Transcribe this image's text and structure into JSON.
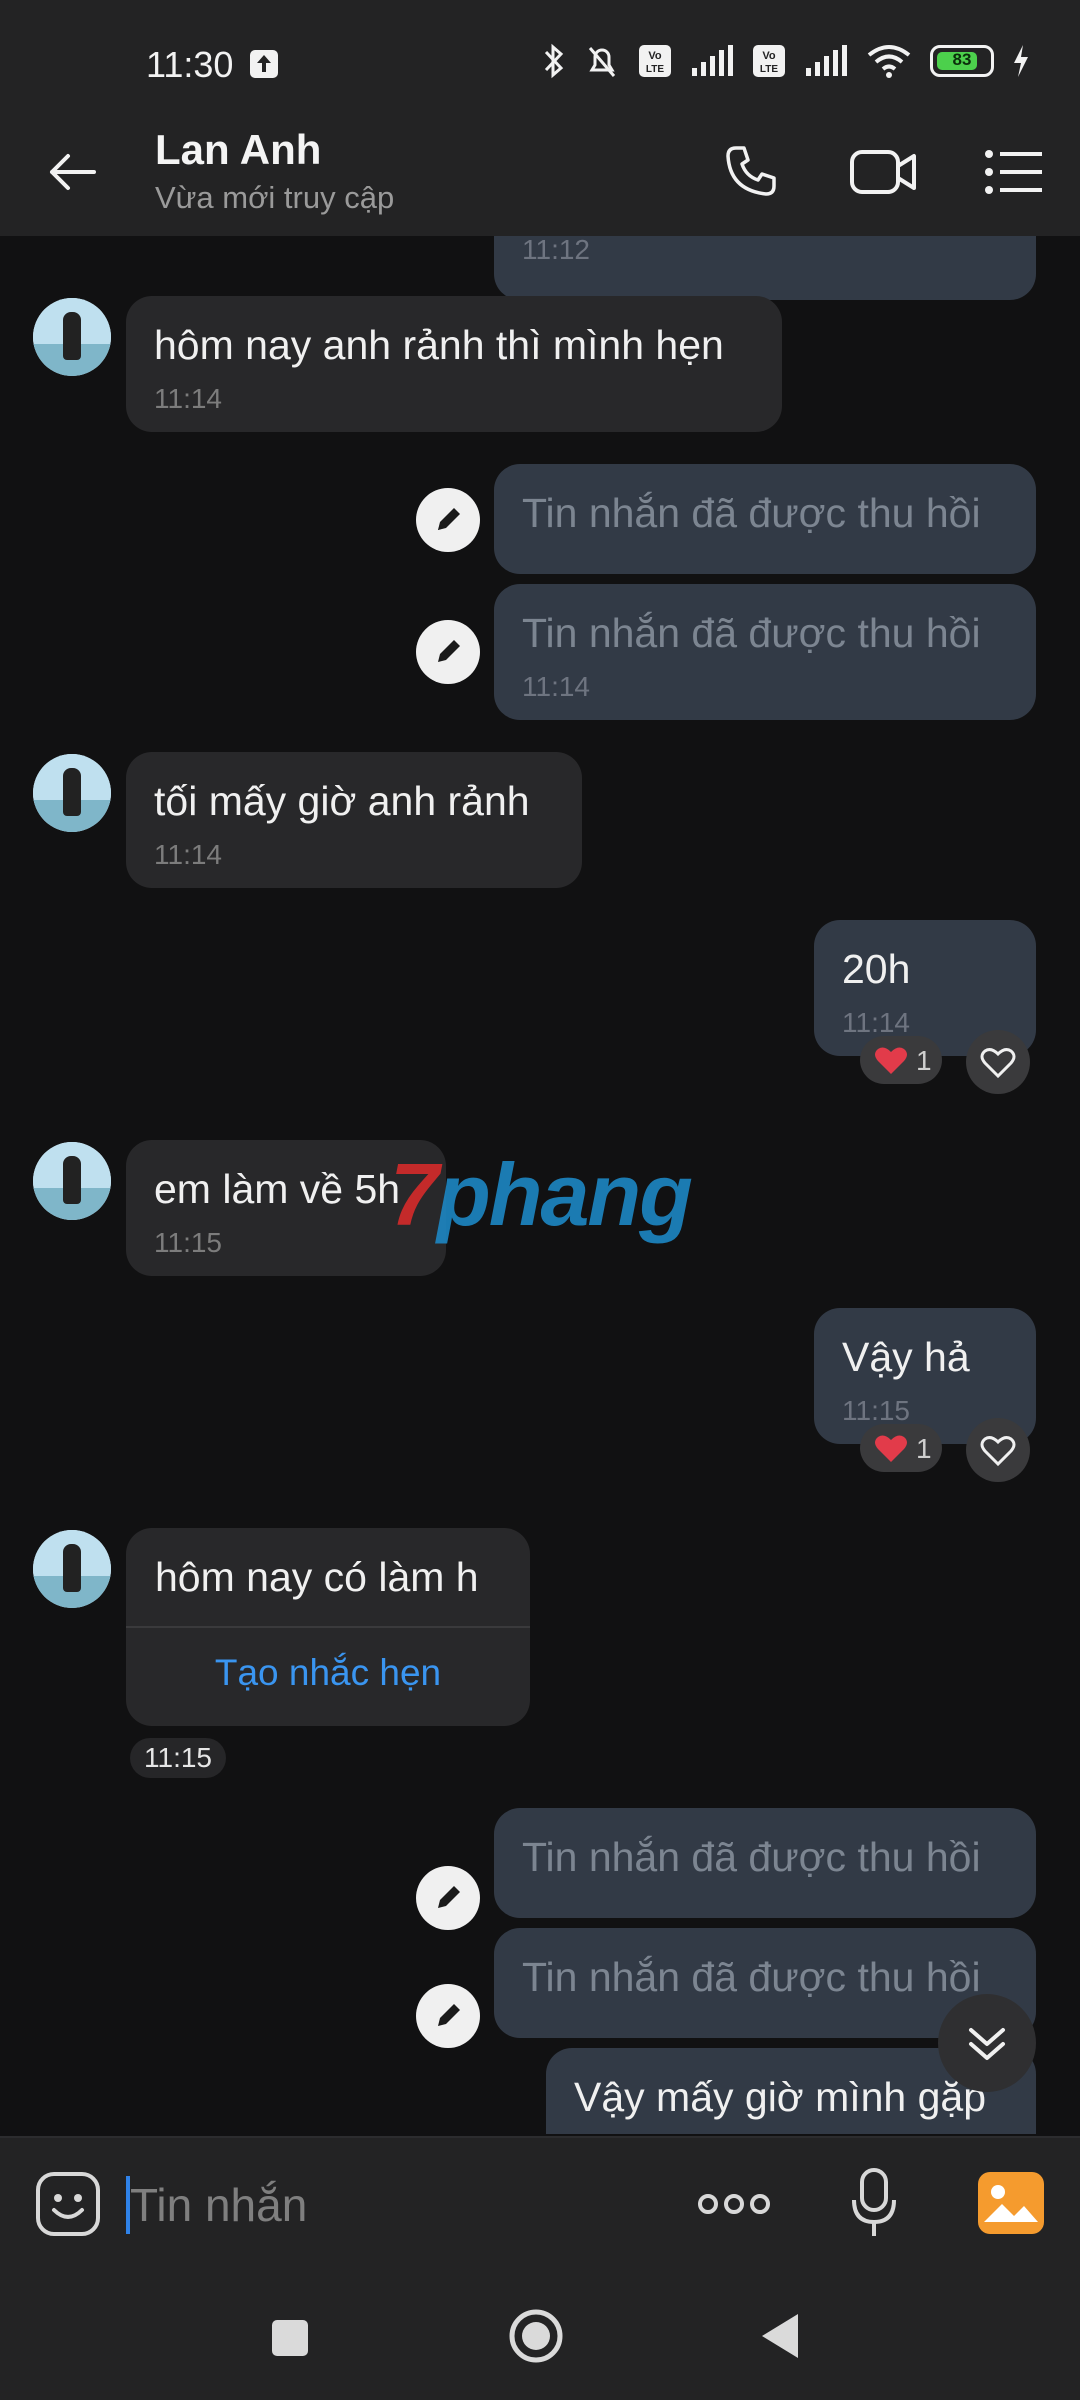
{
  "status_bar": {
    "time": "11:30",
    "battery": "83"
  },
  "header": {
    "contact_name": "Lan Anh",
    "status": "Vừa mới truy cập"
  },
  "messages": {
    "top_cut_time": "11:12",
    "m1": {
      "text": "hôm nay anh rảnh thì mình hẹn",
      "time": "11:14"
    },
    "m2": {
      "text": "Tin nhắn đã được thu hồi"
    },
    "m3": {
      "text": "Tin nhắn đã được thu hồi",
      "time": "11:14"
    },
    "m4": {
      "text": "tối mấy giờ anh rảnh",
      "time": "11:14"
    },
    "m5": {
      "text": "20h",
      "time": "11:14",
      "reaction_count": "1"
    },
    "m6": {
      "text": "em làm về 5h",
      "time": "11:15"
    },
    "m7": {
      "text": "Vậy hả",
      "time": "11:15",
      "reaction_count": "1"
    },
    "m8": {
      "text": "hôm nay có làm h",
      "action": "Tạo nhắc hẹn",
      "time": "11:15"
    },
    "m9": {
      "text": "Tin nhắn đã được thu hồi"
    },
    "m10": {
      "text": "Tin nhắn đã được thu hồi"
    },
    "m11": {
      "text": "Vậy mấy giờ mình gặp"
    }
  },
  "watermark": {
    "prefix": "7",
    "text": "phang"
  },
  "input": {
    "placeholder": "Tin nhắn"
  },
  "icons": [
    "back-arrow-icon",
    "phone-icon",
    "video-icon",
    "menu-list-icon",
    "emoji-icon",
    "more-icon",
    "mic-icon",
    "image-icon",
    "pencil-icon",
    "heart-icon",
    "chevrons-down-icon",
    "nav-recents-icon",
    "nav-home-icon",
    "nav-back-icon"
  ],
  "colors": {
    "accent": "#3a95f0",
    "outgoing_bubble": "#323a46",
    "incoming_bubble": "#28282a",
    "image_button": "#f59b2e"
  }
}
